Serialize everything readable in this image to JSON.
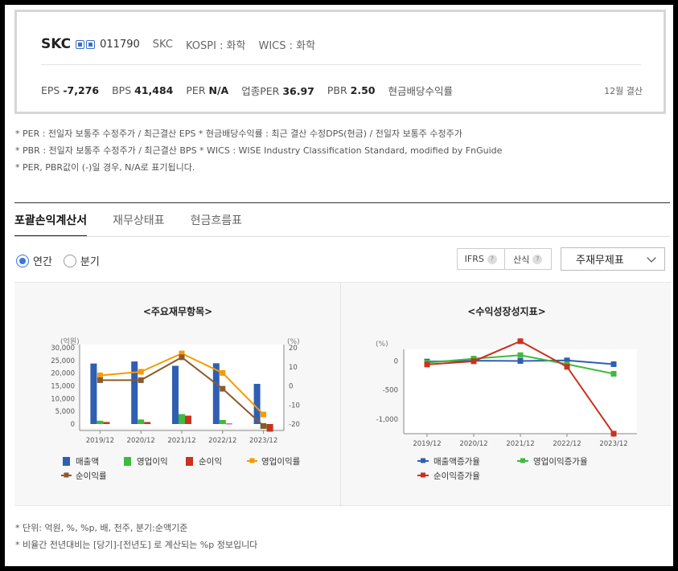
{
  "header": {
    "company_name": "SKC",
    "stock_code": "011790",
    "ticker": "SKC",
    "market": "KOSPI : 화학",
    "wics": "WICS : 화학",
    "eps_label": "EPS",
    "eps_value": "-7,276",
    "bps_label": "BPS",
    "bps_value": "41,484",
    "per_label": "PER",
    "per_value": "N/A",
    "sector_per_label": "업종PER",
    "sector_per_value": "36.97",
    "pbr_label": "PBR",
    "pbr_value": "2.50",
    "dividend_label": "현금배당수익률",
    "settlement": "12월 결산"
  },
  "notes": [
    "* PER : 전일자 보통주 수정주가 / 최근결산 EPS * 현금배당수익률 : 최근 결산 수정DPS(현금) / 전일자 보통주 수정주가",
    "* PBR : 전일자 보통주 수정주가 / 최근결산 BPS * WICS : WISE Industry Classification Standard, modified by FnGuide",
    "* PER, PBR값이 (-)일 경우, N/A로 표기됩니다."
  ],
  "tabs": [
    "포괄손익계산서",
    "재무상태표",
    "현금흐름표"
  ],
  "period": {
    "annual": "연간",
    "quarterly": "분기"
  },
  "options": {
    "ifrs": "IFRS",
    "calc": "산식",
    "help": "?"
  },
  "statement_select": "주재무제표",
  "charts": {
    "left_title": "<주요재무항목>",
    "right_title": "<수익성장성지표>"
  },
  "chart_data": [
    {
      "type": "bar",
      "title": "<주요재무항목>",
      "categories": [
        "2019/12",
        "2020/12",
        "2021/12",
        "2022/12",
        "2023/12"
      ],
      "y_left_label": "(억원)",
      "y_right_label": "(%)",
      "y_left_ticks": [
        "30,000",
        "25,000",
        "20,000",
        "15,000",
        "10,000",
        "5,000",
        "0"
      ],
      "y_right_ticks": [
        "20",
        "10",
        "0",
        "-10",
        "-20"
      ],
      "ylim_left": [
        0,
        30000
      ],
      "ylim_right": [
        -20,
        20
      ],
      "series": [
        {
          "name": "매출액",
          "kind": "bar",
          "axis": "left",
          "color": "#2f5fb3",
          "values": [
            23800,
            24600,
            22900,
            23900,
            15800
          ]
        },
        {
          "name": "영업이익",
          "kind": "bar",
          "axis": "left",
          "color": "#3dbb3d",
          "values": [
            1300,
            1800,
            3900,
            1600,
            -1900
          ]
        },
        {
          "name": "순이익",
          "kind": "bar",
          "axis": "left",
          "color": "#c8321e",
          "values": [
            800,
            800,
            3300,
            200,
            -3000
          ]
        },
        {
          "name": "영업이익률",
          "kind": "line",
          "axis": "right",
          "color": "#f59a00",
          "values": [
            5.5,
            7.4,
            17.0,
            6.8,
            -15.0
          ]
        },
        {
          "name": "순이익률",
          "kind": "line",
          "axis": "right",
          "color": "#8b5a2b",
          "values": [
            3.0,
            3.0,
            15.0,
            -1.5,
            -21.0
          ]
        }
      ]
    },
    {
      "type": "line",
      "title": "<수익성장성지표>",
      "categories": [
        "2019/12",
        "2020/12",
        "2021/12",
        "2022/12",
        "2023/12"
      ],
      "y_label": "(%)",
      "y_ticks": [
        "0",
        "-500",
        "-1,000"
      ],
      "ylim": [
        -1250,
        200
      ],
      "series": [
        {
          "name": "매출액증가율",
          "color": "#2f5fb3",
          "values": [
            -10,
            5,
            0,
            10,
            -55
          ]
        },
        {
          "name": "영업이익증가율",
          "color": "#3dbb3d",
          "values": [
            -30,
            40,
            100,
            -55,
            -220
          ]
        },
        {
          "name": "순이익증가율",
          "color": "#c8321e",
          "values": [
            -60,
            -5,
            340,
            -100,
            -1250
          ]
        }
      ]
    }
  ],
  "footnotes": [
    "* 단위: 억원, %, %p, 배, 천주, 분기:순액기준",
    "* 비율간 전년대비는 [당기]-[전년도] 로 계산되는 %p 정보입니다"
  ]
}
